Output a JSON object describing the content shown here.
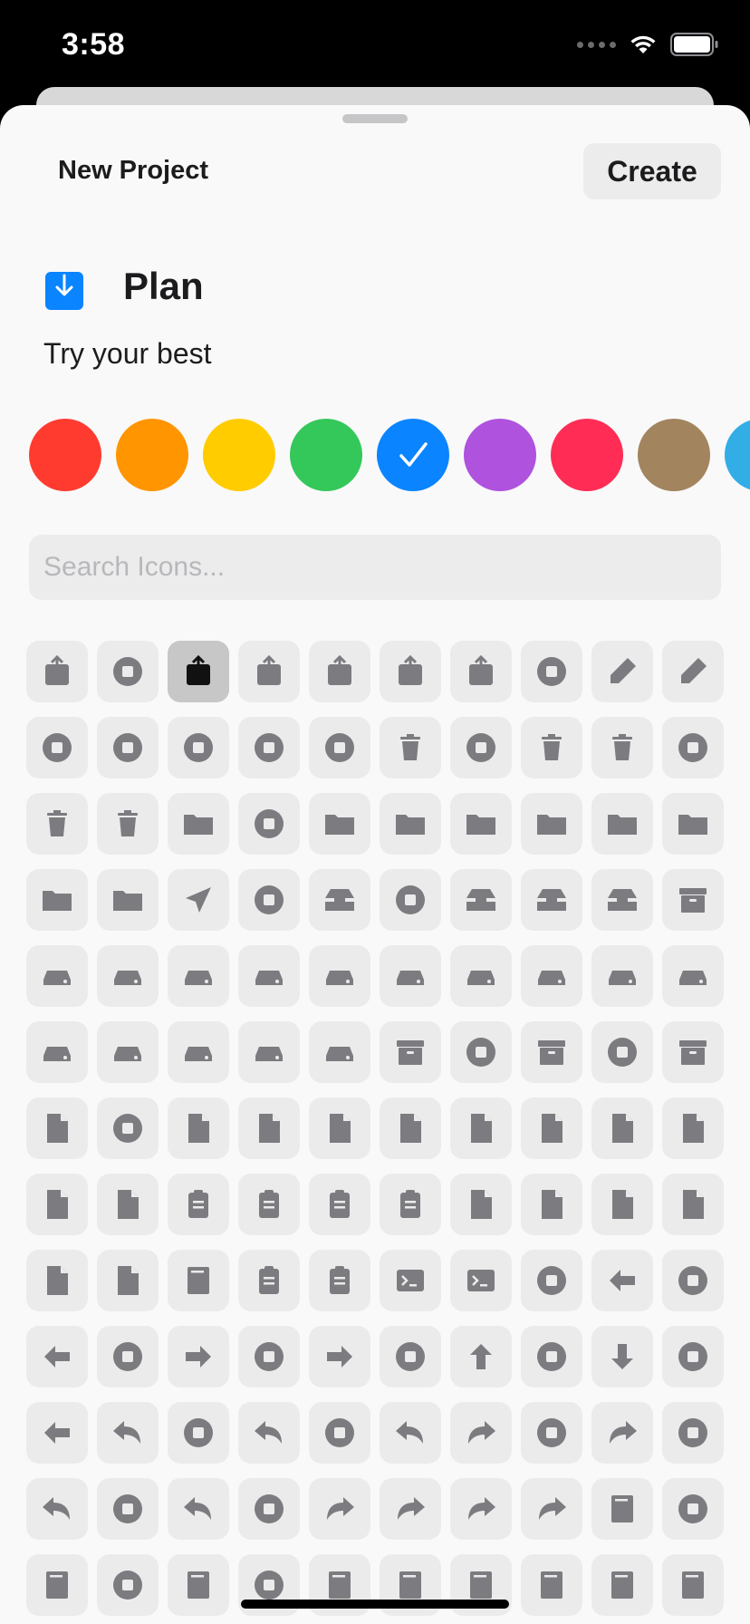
{
  "status_bar": {
    "time": "3:58"
  },
  "sheet": {
    "title": "New Project",
    "create_label": "Create",
    "project": {
      "name": "Plan",
      "description": "Try your best",
      "icon": "tray-arrow-down-icon"
    },
    "colors": [
      {
        "name": "red",
        "hex": "#FF3B30",
        "selected": false
      },
      {
        "name": "orange",
        "hex": "#FF9500",
        "selected": false
      },
      {
        "name": "yellow",
        "hex": "#FFCC00",
        "selected": false
      },
      {
        "name": "green",
        "hex": "#34C759",
        "selected": false
      },
      {
        "name": "blue",
        "hex": "#0A84FF",
        "selected": true
      },
      {
        "name": "purple",
        "hex": "#AF52DE",
        "selected": false
      },
      {
        "name": "pink",
        "hex": "#FF2D55",
        "selected": false
      },
      {
        "name": "brown",
        "hex": "#A2845E",
        "selected": false
      },
      {
        "name": "cyan",
        "hex": "#32ADE6",
        "selected": false
      }
    ],
    "search": {
      "placeholder": "Search Icons...",
      "value": ""
    },
    "icons": [
      "square-arrow-up",
      "circle-arrow-up",
      "square-arrow-down",
      "stack-arrow-up",
      "stack-arrow-down",
      "rect-arrow-right",
      "rect-arrow-right-fill",
      "pencil-circle",
      "eraser",
      "eraser-line",
      "square-pencil-circle",
      "a-circle",
      "a-circle-plus",
      "a-circle-minus",
      "a-circle-arrow",
      "trash",
      "trash-circle",
      "trash-square",
      "trash-slash",
      "trash-slash-circle",
      "trash-slash-square",
      "trash-arrow-up",
      "folder",
      "folder-circle",
      "folder-plus",
      "folder-minus",
      "folder-question",
      "folder-person",
      "folder-dots-plus",
      "folder-gear",
      "folder-plus-alt",
      "questionmark-folder",
      "paperplane",
      "paperplane-circle",
      "tray",
      "tray-circle",
      "tray-full",
      "tray-arrow-up",
      "tray-arrow-down",
      "archivebox-stack",
      "drive",
      "drive-plus",
      "drive-minus",
      "drive-check",
      "drive-xmark",
      "drive-question",
      "drive-exclamation",
      "drive-person",
      "drive-wifi",
      "drive-cloud",
      "drive-warning",
      "drive-clock",
      "drive-grille",
      "drive-slot",
      "server-network",
      "archivebox",
      "archivebox-circle",
      "archivebox-xmark",
      "archivebox-xmark-circle",
      "archivebox-arrow-up",
      "doc",
      "doc-circle",
      "doc-plus",
      "doc-arrow-up",
      "doc-ellipsis",
      "doc-clock",
      "doc-gear",
      "doc-lock",
      "doc-arrow-up-alt",
      "doc-arrow-down",
      "doc-text",
      "doc-on-doc",
      "doc-on-clipboard",
      "clipboard",
      "list-clipboard",
      "clipboard-text",
      "doc-richtext",
      "doc-plaintext",
      "doc-quote",
      "doc-waveform",
      "doc-questionmark",
      "doc-append",
      "book-pages",
      "list-bullet-rect",
      "list-bullet-rect-alt",
      "terminal",
      "terminal-stack",
      "calendar-circle",
      "arrow-left",
      "arrow-left-circle",
      "arrow-left-fill",
      "arrow-left-circle-alt",
      "arrow-right",
      "arrow-right-circle",
      "arrow-right-alt",
      "arrow-right-circle-alt",
      "arrow-up",
      "arrow-up-circle",
      "arrow-down",
      "arrow-down-circle",
      "arrow-left-right",
      "arrowshape-turn-up-left",
      "arrowshape-turn-up-left-circle",
      "arrowshape-turn-up-left-alt",
      "arrowshape-turn-up-left-circle-alt",
      "arrowshape-clock",
      "arrowshape-turn-up-right",
      "arrowshape-turn-up-right-circle",
      "arrowshape-turn-up-right-alt",
      "arrowshape-turn-up-right-circle-alt",
      "arrowshape-reply-all",
      "arrowshape-reply-all-circle",
      "arrowshape-reply-all-alt",
      "arrowshape-reply-all-circle-alt",
      "arrowshape-bounce-right",
      "arrowshape-bounce-right-alt",
      "arrowshape-zigzag",
      "arrowshape-zigzag-alt",
      "book",
      "book-circle",
      "books-vertical",
      "books-circle",
      "book-closed",
      "book-closed-circle",
      "character-book",
      "text-book",
      "newspaper-book",
      "viewfinder-book",
      "bookmark-book",
      "newspaper"
    ],
    "selected_icon_index": 2
  },
  "colors": {
    "icon_gray": "#7c7c80",
    "selected_icon": "#111111"
  }
}
